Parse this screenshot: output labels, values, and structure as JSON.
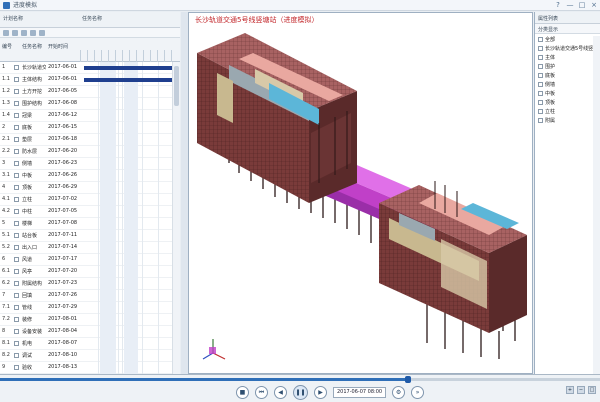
{
  "app": {
    "title": "进度模拟",
    "window_buttons": [
      "?",
      "—",
      "□",
      "×"
    ]
  },
  "schedule": {
    "panel_tabs": [
      "计划名称",
      "任务名称"
    ],
    "columns": [
      "编号",
      "任务名称",
      "开始时间"
    ],
    "rows": [
      {
        "num": "1",
        "name": "长沙轨道交通",
        "date": "2017-06-01"
      },
      {
        "num": "1.1",
        "name": "主体结构",
        "date": "2017-06-01"
      },
      {
        "num": "1.2",
        "name": "土方开挖",
        "date": "2017-06-05"
      },
      {
        "num": "1.3",
        "name": "围护结构",
        "date": "2017-06-08"
      },
      {
        "num": "1.4",
        "name": "冠梁",
        "date": "2017-06-12"
      },
      {
        "num": "2",
        "name": "底板",
        "date": "2017-06-15"
      },
      {
        "num": "2.1",
        "name": "垫层",
        "date": "2017-06-18"
      },
      {
        "num": "2.2",
        "name": "防水层",
        "date": "2017-06-20"
      },
      {
        "num": "3",
        "name": "侧墙",
        "date": "2017-06-23"
      },
      {
        "num": "3.1",
        "name": "中板",
        "date": "2017-06-26"
      },
      {
        "num": "4",
        "name": "顶板",
        "date": "2017-06-29"
      },
      {
        "num": "4.1",
        "name": "立柱",
        "date": "2017-07-02"
      },
      {
        "num": "4.2",
        "name": "中柱",
        "date": "2017-07-05"
      },
      {
        "num": "5",
        "name": "楼梯",
        "date": "2017-07-08"
      },
      {
        "num": "5.1",
        "name": "站台板",
        "date": "2017-07-11"
      },
      {
        "num": "5.2",
        "name": "出入口",
        "date": "2017-07-14"
      },
      {
        "num": "6",
        "name": "风道",
        "date": "2017-07-17"
      },
      {
        "num": "6.1",
        "name": "风亭",
        "date": "2017-07-20"
      },
      {
        "num": "6.2",
        "name": "附属结构",
        "date": "2017-07-23"
      },
      {
        "num": "7",
        "name": "回填",
        "date": "2017-07-26"
      },
      {
        "num": "7.1",
        "name": "管线",
        "date": "2017-07-29"
      },
      {
        "num": "7.2",
        "name": "装修",
        "date": "2017-08-01"
      },
      {
        "num": "8",
        "name": "设备安装",
        "date": "2017-08-04"
      },
      {
        "num": "8.1",
        "name": "机电",
        "date": "2017-08-07"
      },
      {
        "num": "8.2",
        "name": "调试",
        "date": "2017-08-10"
      },
      {
        "num": "9",
        "name": "验收",
        "date": "2017-08-13"
      }
    ]
  },
  "viewport": {
    "title": "长沙轨道交通5号线竖塘站（进度模拟）"
  },
  "properties": {
    "header": "属性列表",
    "toolbar": "分类显示",
    "tree": [
      "全部",
      "长沙轨道交通5号线竖塘站",
      "主体",
      "围护",
      "底板",
      "侧墙",
      "中板",
      "顶板",
      "立柱",
      "附属"
    ]
  },
  "playback": {
    "date_text": "2017-06-07 08:00",
    "progress": 0.68,
    "colors": {
      "accent": "#2f6fb8"
    }
  }
}
